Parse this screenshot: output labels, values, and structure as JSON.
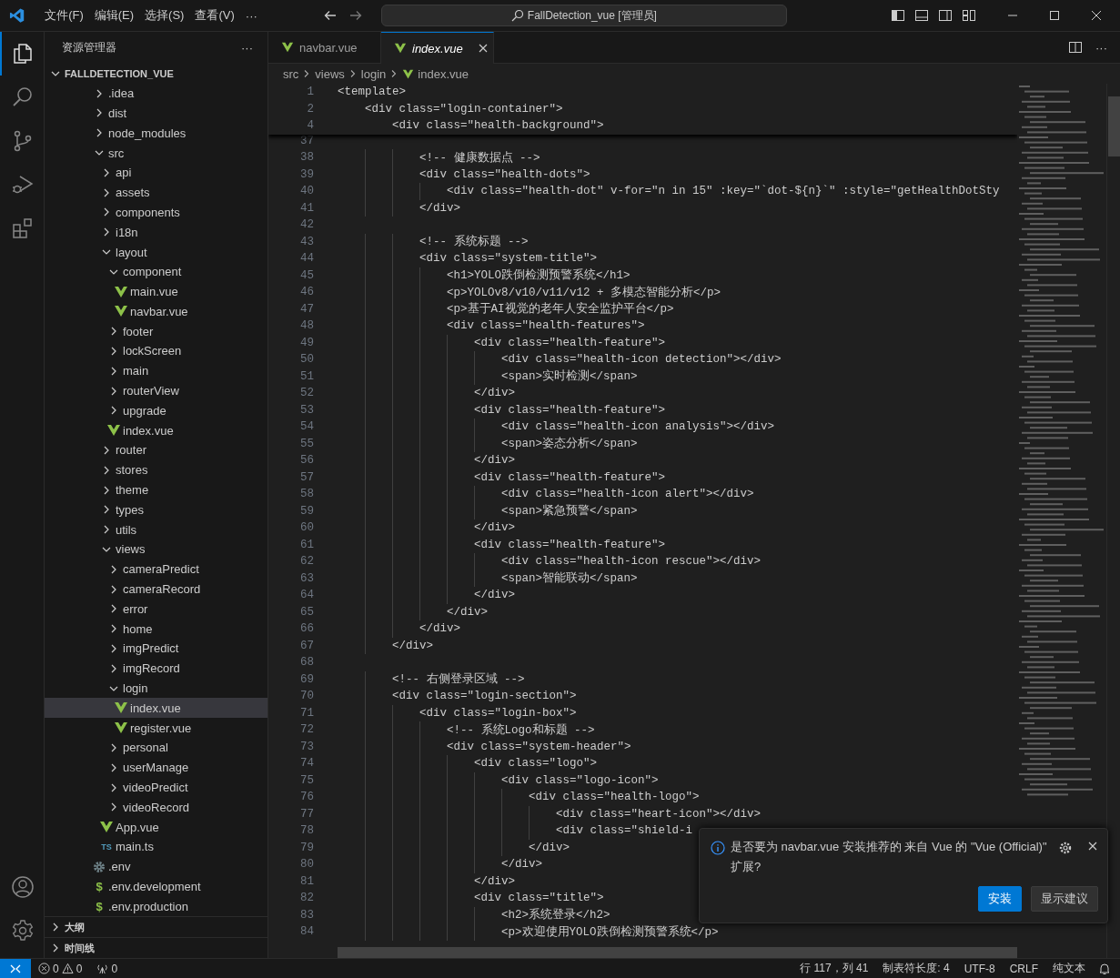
{
  "menu": [
    "文件(F)",
    "编辑(E)",
    "选择(S)",
    "查看(V)",
    "···"
  ],
  "command_center": {
    "text": "FallDetection_vue [管理员]"
  },
  "explorer": {
    "title": "资源管理器",
    "more": "···",
    "root": {
      "label": "FALLDETECTION_VUE",
      "expanded": true
    },
    "tree": [
      {
        "label": ".idea",
        "kind": "folder",
        "expanded": false,
        "selected": false
      },
      {
        "label": "dist",
        "kind": "folder",
        "expanded": false,
        "selected": false
      },
      {
        "label": "node_modules",
        "kind": "folder",
        "expanded": false,
        "selected": false
      },
      {
        "label": "src",
        "kind": "folder",
        "expanded": true,
        "selected": false,
        "children": [
          {
            "label": "api",
            "kind": "folder",
            "expanded": false,
            "selected": false
          },
          {
            "label": "assets",
            "kind": "folder",
            "expanded": false,
            "selected": false
          },
          {
            "label": "components",
            "kind": "folder",
            "expanded": false,
            "selected": false
          },
          {
            "label": "i18n",
            "kind": "folder",
            "expanded": false,
            "selected": false
          },
          {
            "label": "layout",
            "kind": "folder",
            "expanded": true,
            "selected": false,
            "children": [
              {
                "label": "component",
                "kind": "folder",
                "expanded": true,
                "selected": false,
                "children": [
                  {
                    "label": "main.vue",
                    "kind": "vue",
                    "selected": false
                  },
                  {
                    "label": "navbar.vue",
                    "kind": "vue",
                    "selected": false
                  }
                ]
              },
              {
                "label": "footer",
                "kind": "folder",
                "expanded": false,
                "selected": false
              },
              {
                "label": "lockScreen",
                "kind": "folder",
                "expanded": false,
                "selected": false
              },
              {
                "label": "main",
                "kind": "folder",
                "expanded": false,
                "selected": false
              },
              {
                "label": "routerView",
                "kind": "folder",
                "expanded": false,
                "selected": false
              },
              {
                "label": "upgrade",
                "kind": "folder",
                "expanded": false,
                "selected": false
              },
              {
                "label": "index.vue",
                "kind": "vue",
                "selected": false
              }
            ]
          },
          {
            "label": "router",
            "kind": "folder",
            "expanded": false,
            "selected": false
          },
          {
            "label": "stores",
            "kind": "folder",
            "expanded": false,
            "selected": false
          },
          {
            "label": "theme",
            "kind": "folder",
            "expanded": false,
            "selected": false
          },
          {
            "label": "types",
            "kind": "folder",
            "expanded": false,
            "selected": false
          },
          {
            "label": "utils",
            "kind": "folder",
            "expanded": false,
            "selected": false
          },
          {
            "label": "views",
            "kind": "folder",
            "expanded": true,
            "selected": false,
            "children": [
              {
                "label": "cameraPredict",
                "kind": "folder",
                "expanded": false,
                "selected": false
              },
              {
                "label": "cameraRecord",
                "kind": "folder",
                "expanded": false,
                "selected": false
              },
              {
                "label": "error",
                "kind": "folder",
                "expanded": false,
                "selected": false
              },
              {
                "label": "home",
                "kind": "folder",
                "expanded": false,
                "selected": false
              },
              {
                "label": "imgPredict",
                "kind": "folder",
                "expanded": false,
                "selected": false
              },
              {
                "label": "imgRecord",
                "kind": "folder",
                "expanded": false,
                "selected": false
              },
              {
                "label": "login",
                "kind": "folder",
                "expanded": true,
                "selected": false,
                "children": [
                  {
                    "label": "index.vue",
                    "kind": "vue",
                    "selected": true
                  },
                  {
                    "label": "register.vue",
                    "kind": "vue",
                    "selected": false
                  }
                ]
              },
              {
                "label": "personal",
                "kind": "folder",
                "expanded": false,
                "selected": false
              },
              {
                "label": "userManage",
                "kind": "folder",
                "expanded": false,
                "selected": false
              },
              {
                "label": "videoPredict",
                "kind": "folder",
                "expanded": false,
                "selected": false
              },
              {
                "label": "videoRecord",
                "kind": "folder",
                "expanded": false,
                "selected": false
              }
            ]
          },
          {
            "label": "App.vue",
            "kind": "vue",
            "selected": false
          },
          {
            "label": "main.ts",
            "kind": "ts",
            "icon": "TS",
            "selected": false
          }
        ]
      },
      {
        "label": ".env",
        "kind": "config",
        "selected": false
      },
      {
        "label": ".env.development",
        "kind": "env",
        "icon": "$",
        "selected": false
      },
      {
        "label": ".env.production",
        "kind": "env",
        "icon": "$",
        "selected": false
      }
    ],
    "sections": [
      {
        "label": "大纲",
        "expanded": false
      },
      {
        "label": "时间线",
        "expanded": false
      }
    ]
  },
  "tabs": [
    {
      "label": "navbar.vue",
      "selected": false,
      "preview": false
    },
    {
      "label": "index.vue",
      "selected": true,
      "preview": true
    }
  ],
  "breadcrumbs": [
    {
      "label": "src",
      "kind": "folder"
    },
    {
      "label": "views",
      "kind": "folder"
    },
    {
      "label": "login",
      "kind": "folder"
    },
    {
      "label": "index.vue",
      "kind": "vue"
    }
  ],
  "sticky_lines": [
    {
      "num": "1",
      "text": "<template>"
    },
    {
      "num": "2",
      "text": "    <div class=\"login-container\">"
    },
    {
      "num": "4",
      "text": "        <div class=\"health-background\">"
    }
  ],
  "code_lines": [
    {
      "num": "37"
    },
    {
      "num": "38",
      "text": "            <!-- 健康数据点 -->"
    },
    {
      "num": "39",
      "text": "            <div class=\"health-dots\">"
    },
    {
      "num": "40",
      "text": "                <div class=\"health-dot\" v-for=\"n in 15\" :key=\"`dot-${n}`\" :style=\"getHealthDotSty"
    },
    {
      "num": "41",
      "text": "            </div>"
    },
    {
      "num": "42"
    },
    {
      "num": "43",
      "text": "            <!-- 系统标题 -->"
    },
    {
      "num": "44",
      "text": "            <div class=\"system-title\">"
    },
    {
      "num": "45",
      "text": "                <h1>YOLO跌倒检测预警系统</h1>"
    },
    {
      "num": "46",
      "text": "                <p>YOLOv8/v10/v11/v12 + 多模态智能分析</p>"
    },
    {
      "num": "47",
      "text": "                <p>基于AI视觉的老年人安全监护平台</p>"
    },
    {
      "num": "48",
      "text": "                <div class=\"health-features\">"
    },
    {
      "num": "49",
      "text": "                    <div class=\"health-feature\">"
    },
    {
      "num": "50",
      "text": "                        <div class=\"health-icon detection\"></div>"
    },
    {
      "num": "51",
      "text": "                        <span>实时检测</span>"
    },
    {
      "num": "52",
      "text": "                    </div>"
    },
    {
      "num": "53",
      "text": "                    <div class=\"health-feature\">"
    },
    {
      "num": "54",
      "text": "                        <div class=\"health-icon analysis\"></div>"
    },
    {
      "num": "55",
      "text": "                        <span>姿态分析</span>"
    },
    {
      "num": "56",
      "text": "                    </div>"
    },
    {
      "num": "57",
      "text": "                    <div class=\"health-feature\">"
    },
    {
      "num": "58",
      "text": "                        <div class=\"health-icon alert\"></div>"
    },
    {
      "num": "59",
      "text": "                        <span>紧急预警</span>"
    },
    {
      "num": "60",
      "text": "                    </div>"
    },
    {
      "num": "61",
      "text": "                    <div class=\"health-feature\">"
    },
    {
      "num": "62",
      "text": "                        <div class=\"health-icon rescue\"></div>"
    },
    {
      "num": "63",
      "text": "                        <span>智能联动</span>"
    },
    {
      "num": "64",
      "text": "                    </div>"
    },
    {
      "num": "65",
      "text": "                </div>"
    },
    {
      "num": "66",
      "text": "            </div>"
    },
    {
      "num": "67",
      "text": "        </div>"
    },
    {
      "num": "68"
    },
    {
      "num": "69",
      "text": "        <!-- 右侧登录区域 -->"
    },
    {
      "num": "70",
      "text": "        <div class=\"login-section\">"
    },
    {
      "num": "71",
      "text": "            <div class=\"login-box\">"
    },
    {
      "num": "72",
      "text": "                <!-- 系统Logo和标题 -->"
    },
    {
      "num": "73",
      "text": "                <div class=\"system-header\">"
    },
    {
      "num": "74",
      "text": "                    <div class=\"logo\">"
    },
    {
      "num": "75",
      "text": "                        <div class=\"logo-icon\">"
    },
    {
      "num": "76",
      "text": "                            <div class=\"health-logo\">"
    },
    {
      "num": "77",
      "text": "                                <div class=\"heart-icon\"></div>"
    },
    {
      "num": "78",
      "text": "                                <div class=\"shield-i"
    },
    {
      "num": "79",
      "text": "                            </div>"
    },
    {
      "num": "80",
      "text": "                        </div>"
    },
    {
      "num": "81",
      "text": "                    </div>"
    },
    {
      "num": "82",
      "text": "                    <div class=\"title\">"
    },
    {
      "num": "83",
      "text": "                        <h2>系统登录</h2>"
    },
    {
      "num": "84",
      "text": "                        <p>欢迎使用YOLO跌倒检测预警系统</p>"
    }
  ],
  "notification": {
    "message": "是否要为 navbar.vue 安装推荐的 来自 Vue 的 \"Vue (Official)\" 扩展?",
    "buttons": [
      {
        "label": "安装",
        "primary": true
      },
      {
        "label": "显示建议",
        "primary": false
      }
    ]
  },
  "status_bar": {
    "errors": "0",
    "warnings": "0",
    "ports": "0",
    "right": [
      "行 117，列 41",
      "制表符长度: 4",
      "UTF-8",
      "CRLF",
      "纯文本"
    ]
  }
}
